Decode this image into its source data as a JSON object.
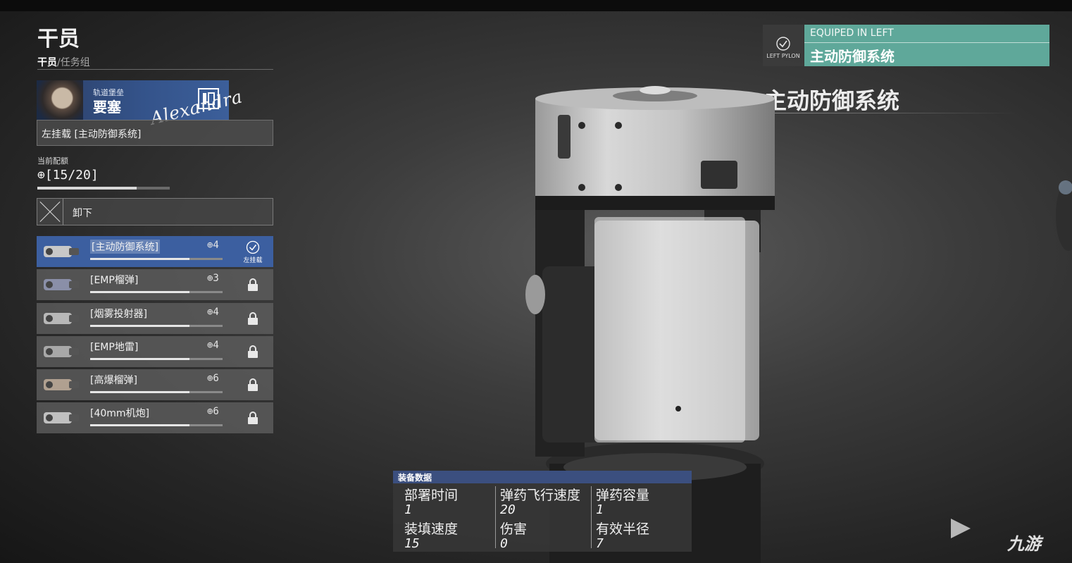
{
  "header": {
    "title": "干员",
    "breadcrumb_current": "干员",
    "breadcrumb_rest": "/任务组"
  },
  "character": {
    "subtitle": "轨道堡垒",
    "name": "要塞",
    "signature": "Alexandra",
    "loadout": "左挂载 [主动防御系统]"
  },
  "quota": {
    "label": "当前配额",
    "value": "⊕[15/20]",
    "current": 15,
    "max": 20
  },
  "unequip": {
    "label": "卸下",
    "icon": "x-icon"
  },
  "items": [
    {
      "name": "[主动防御系统]",
      "cost": "⊕4",
      "status": "equipped",
      "status_label": "左挂载",
      "selected": true,
      "icon": "defense-system-icon"
    },
    {
      "name": "[EMP榴弹]",
      "cost": "⊕3",
      "status": "locked",
      "selected": false,
      "icon": "emp-grenade-icon"
    },
    {
      "name": "[烟雾投射器]",
      "cost": "⊕4",
      "status": "locked",
      "selected": false,
      "icon": "smoke-launcher-icon"
    },
    {
      "name": "[EMP地雷]",
      "cost": "⊕4",
      "status": "locked",
      "selected": false,
      "icon": "emp-mine-icon"
    },
    {
      "name": "[高爆榴弹]",
      "cost": "⊕6",
      "status": "locked",
      "selected": false,
      "icon": "he-grenade-icon"
    },
    {
      "name": "[40mm机炮]",
      "cost": "⊕6",
      "status": "locked",
      "selected": false,
      "icon": "autocannon-icon"
    }
  ],
  "equipped": {
    "pylon_label": "LEFT PYLON",
    "header": "EQUIPED IN LEFT",
    "name": "主动防御系统",
    "accent": "#5fa89a"
  },
  "weapon_title": "主动防御系统",
  "stats": {
    "title": "装备数据",
    "entries": [
      {
        "label": "部署时间",
        "value": "1"
      },
      {
        "label": "弹药飞行速度",
        "value": "20"
      },
      {
        "label": "弹药容量",
        "value": "1"
      },
      {
        "label": "装填速度",
        "value": "15"
      },
      {
        "label": "伤害",
        "value": "0"
      },
      {
        "label": "有效半径",
        "value": "7"
      }
    ]
  },
  "watermark": "九游",
  "colors": {
    "selected": "#3c5fa0",
    "panel": "#5f5f5f",
    "stats_header": "#3b4f7f"
  }
}
